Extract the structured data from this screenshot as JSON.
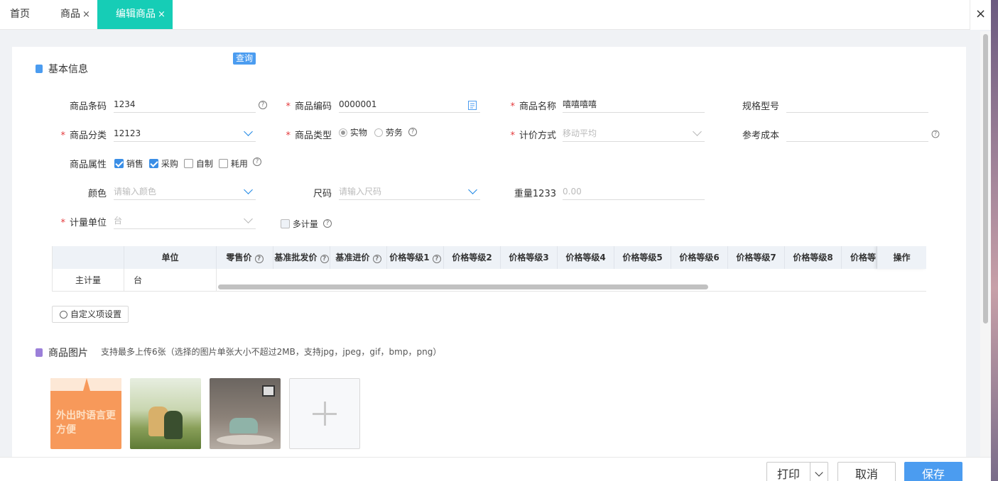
{
  "tabs": {
    "home": "首页",
    "goods": "商品",
    "edit": "编辑商品",
    "close_glyph": "×",
    "close_all_glyph": "×"
  },
  "basic_section": {
    "title": "基本信息",
    "icon_color": "#4b9cf0"
  },
  "fields": {
    "barcode": {
      "label": "商品条码",
      "value": "1234",
      "query_button": "查询"
    },
    "code": {
      "label": "商品编码",
      "value": "0000001"
    },
    "name": {
      "label": "商品名称",
      "value": "嘻嘻嘻嘻"
    },
    "spec": {
      "label": "规格型号",
      "value": ""
    },
    "category": {
      "label": "商品分类",
      "value": "12123"
    },
    "type": {
      "label": "商品类型",
      "options": [
        "实物",
        "劳务"
      ],
      "selected": "实物"
    },
    "pricing": {
      "label": "计价方式",
      "value": "移动平均"
    },
    "ref_cost": {
      "label": "参考成本",
      "value": ""
    },
    "attributes": {
      "label": "商品属性",
      "options": [
        {
          "label": "销售",
          "checked": true
        },
        {
          "label": "采购",
          "checked": true
        },
        {
          "label": "自制",
          "checked": false
        },
        {
          "label": "耗用",
          "checked": false
        }
      ]
    },
    "color": {
      "label": "颜色",
      "placeholder": "请输入颜色"
    },
    "size": {
      "label": "尺码",
      "placeholder": "请输入尺码"
    },
    "weight": {
      "label": "重量1233",
      "placeholder": "0.00"
    },
    "unit": {
      "label": "计量单位",
      "value": "台"
    },
    "multi_unit": {
      "label": "多计量",
      "checked": false
    }
  },
  "required_mark": "*",
  "help_glyph": "?",
  "unit_table": {
    "headers": [
      "单位",
      "零售价",
      "基准批发价",
      "基准进价",
      "价格等级1",
      "价格等级2",
      "价格等级3",
      "价格等级4",
      "价格等级5",
      "价格等级6",
      "价格等级7",
      "价格等级8",
      "价格等",
      "操作"
    ],
    "rows": [
      {
        "type": "主计量",
        "unit": "台"
      }
    ]
  },
  "custom_button": "自定义项设置",
  "image_section": {
    "title": "商品图片",
    "tip": "支持最多上传6张（选择的图片单张大小不超过2MB，支持jpg，jpeg，gif，bmp，png）",
    "icon_color": "#9b7fd9",
    "thumb1_text": "外出时语言更方便"
  },
  "footer": {
    "print": "打印",
    "cancel": "取消",
    "save": "保存"
  },
  "colors": {
    "accent_tab": "#16cdb6",
    "primary": "#4b9cf0",
    "required": "#e4393c"
  }
}
